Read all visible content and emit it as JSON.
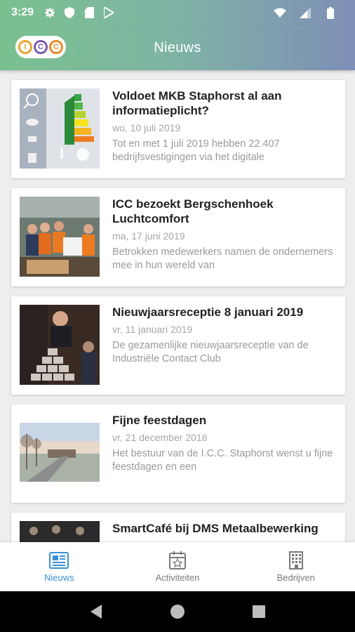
{
  "status_bar": {
    "time": "3:29",
    "icons": [
      "settings-icon",
      "shield-icon",
      "sd-card-icon",
      "play-store-icon"
    ],
    "right_icons": [
      "wifi-icon",
      "signal-icon",
      "battery-icon"
    ]
  },
  "app_bar": {
    "logo_letters": [
      "I",
      "C",
      "C"
    ],
    "title": "Nieuws"
  },
  "colors": {
    "gradient_start": "#79c08e",
    "gradient_end": "#7f8fb6",
    "active_nav": "#3a8fd6",
    "logo_i": "#e8a531",
    "logo_c1": "#7b5db0",
    "logo_c2": "#e58a2e"
  },
  "news": [
    {
      "title": "Voldoet MKB Staphorst al aan informatieplicht?",
      "date": "wo, 10 juli 2019",
      "excerpt": "Tot en met 1 juli 2019 hebben 22.407 bedrijfsvestigingen via het digitale"
    },
    {
      "title": "ICC bezoekt Bergschenhoek Luchtcomfort",
      "date": "ma, 17 juni 2019",
      "excerpt": "Betrokken medewerkers namen de ondernemers mee in hun wereld van"
    },
    {
      "title": "Nieuwjaarsreceptie 8 januari 2019",
      "date": "vr, 11 januari 2019",
      "excerpt": "De gezamenlijke nieuwjaarsreceptie van de Industriële Contact Club"
    },
    {
      "title": "Fijne feestdagen",
      "date": "vr, 21 december 2018",
      "excerpt": "Het bestuur van de I.C.C. Staphorst wenst u fijne feestdagen en een"
    },
    {
      "title": "SmartCafé bij DMS Metaalbewerking",
      "date": "",
      "excerpt": ""
    }
  ],
  "bottom_nav": {
    "items": [
      {
        "label": "Nieuws",
        "icon": "news-icon",
        "active": true
      },
      {
        "label": "Activiteiten",
        "icon": "calendar-icon",
        "active": false
      },
      {
        "label": "Bedrijven",
        "icon": "building-icon",
        "active": false
      }
    ]
  },
  "system_nav": [
    "back-icon",
    "home-icon",
    "recents-icon"
  ]
}
